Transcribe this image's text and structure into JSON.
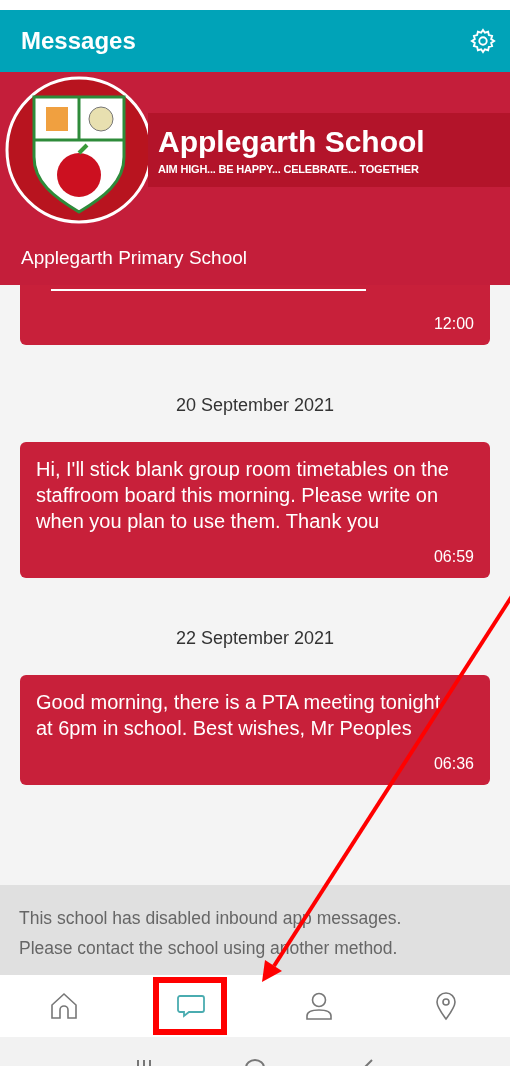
{
  "header": {
    "title": "Messages"
  },
  "banner": {
    "title": "Applegarth School",
    "tagline": "AIM HIGH... BE HAPPY... CELEBRATE... TOGETHER",
    "subtitle": "Applegarth Primary School"
  },
  "feed": [
    {
      "kind": "cut_message",
      "time": "12:00"
    },
    {
      "kind": "date",
      "text": "20 September 2021"
    },
    {
      "kind": "message",
      "text": "Hi, I'll stick blank group room timetables on the staffroom board this morning. Please write on when you plan to use them. Thank you",
      "time": "06:59"
    },
    {
      "kind": "date",
      "text": "22 September 2021"
    },
    {
      "kind": "message",
      "text": "Good morning, there is a PTA meeting tonight at 6pm in school. Best wishes, Mr Peoples",
      "time": "06:36"
    }
  ],
  "notice": {
    "text": "This school has disabled inbound app messages. Please contact the school using another method."
  },
  "nav": [
    {
      "kind": "home",
      "selected": false
    },
    {
      "kind": "chat",
      "selected": true
    },
    {
      "kind": "profile",
      "selected": false
    },
    {
      "kind": "location",
      "selected": false
    }
  ]
}
